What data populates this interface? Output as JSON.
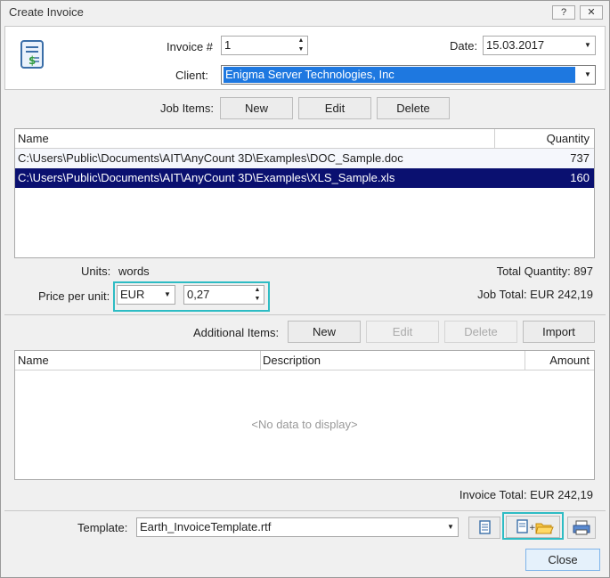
{
  "window": {
    "title": "Create Invoice",
    "help_label": "?",
    "close_label": "✕"
  },
  "header": {
    "invoice_label": "Invoice #",
    "invoice_value": "1",
    "date_label": "Date:",
    "date_value": "15.03.2017",
    "client_label": "Client:",
    "client_value": "Enigma Server Technologies, Inc"
  },
  "job_items": {
    "label": "Job Items:",
    "new_label": "New",
    "edit_label": "Edit",
    "delete_label": "Delete",
    "columns": [
      "Name",
      "Quantity"
    ],
    "rows": [
      {
        "name": "C:\\Users\\Public\\Documents\\AIT\\AnyCount 3D\\Examples\\DOC_Sample.doc",
        "quantity": "737"
      },
      {
        "name": "C:\\Users\\Public\\Documents\\AIT\\AnyCount 3D\\Examples\\XLS_Sample.xls",
        "quantity": "160"
      }
    ],
    "selected_row": 1
  },
  "units": {
    "units_label": "Units:",
    "units_value": "words",
    "total_quantity": "Total Quantity: 897",
    "price_label": "Price per unit:",
    "currency": "EUR",
    "price_value": "0,27",
    "job_total": "Job Total: EUR 242,19"
  },
  "additional_items": {
    "label": "Additional Items:",
    "new_label": "New",
    "edit_label": "Edit",
    "delete_label": "Delete",
    "import_label": "Import",
    "columns": [
      "Name",
      "Description",
      "Amount"
    ],
    "empty_text": "<No data to display>",
    "invoice_total": "Invoice Total: EUR 242,19"
  },
  "footer": {
    "template_label": "Template:",
    "template_value": "Earth_InvoiceTemplate.rtf",
    "close_label": "Close"
  },
  "colors": {
    "accent": "#2ebcc4",
    "selection": "#0a1070",
    "client_highlight": "#1e78e0"
  }
}
